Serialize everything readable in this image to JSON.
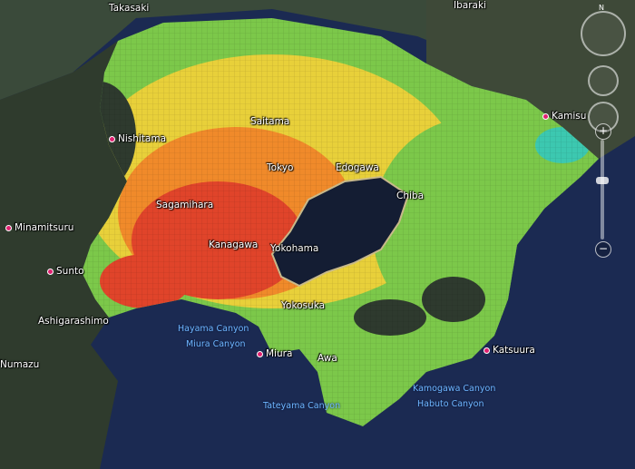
{
  "map": {
    "colors": {
      "ocean": "#1b2a52",
      "land_dark": "#2e3a2e",
      "high": "#e0442a",
      "midhigh": "#f08a2a",
      "mid": "#e8d03a",
      "low": "#7cc84a",
      "lowest": "#3cc8b0",
      "coast": "#c8b98a"
    },
    "places": {
      "takasaki": "Takasaki",
      "ibaraki": "Ibaraki",
      "saitama": "Saitama",
      "kamisu": "Kamisu",
      "nishitama": "Nishitama",
      "tokyo": "Tokyo",
      "edogawa": "Edogawa",
      "chiba": "Chiba",
      "sagamihara": "Sagamihara",
      "minamitsuru": "Minamitsuru",
      "kanagawa": "Kanagawa",
      "yokohama": "Yokohama",
      "sunto": "Sunto",
      "yokosuka": "Yokosuka",
      "ashigarashimo": "Ashigarashimo",
      "miura": "Miura",
      "awa": "Awa",
      "katsuura": "Katsuura",
      "numazu": "Numazu"
    },
    "undersea": {
      "hayama": "Hayama Canyon",
      "miura_canyon": "Miura Canyon",
      "kamogawa": "Kamogawa Canyon",
      "habuto": "Habuto Canyon",
      "tateyama": "Tateyama Canyon"
    }
  },
  "controls": {
    "north": "N",
    "zoom_in": "+",
    "zoom_out": "−",
    "zoom_level": 0.6
  }
}
